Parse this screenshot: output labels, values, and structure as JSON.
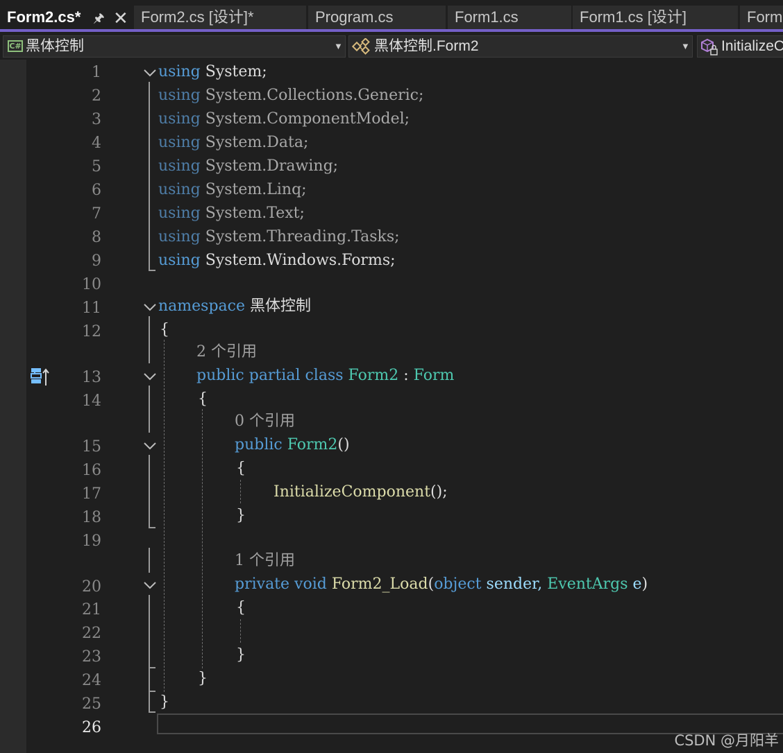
{
  "tabs": [
    {
      "label": "Form2.cs*",
      "active": true
    },
    {
      "label": "Form2.cs [设计]*",
      "active": false
    },
    {
      "label": "Program.cs",
      "active": false
    },
    {
      "label": "Form1.cs",
      "active": false
    },
    {
      "label": "Form1.cs [设计]",
      "active": false
    },
    {
      "label": "Form",
      "active": false
    }
  ],
  "navbar": {
    "project": "黑体控制",
    "type": "黑体控制.Form2",
    "member": "InitializeC"
  },
  "editor": {
    "current_line": 26,
    "line_numbers": [
      "1",
      "2",
      "3",
      "4",
      "5",
      "6",
      "7",
      "8",
      "9",
      "10",
      "11",
      "12",
      "13",
      "14",
      "15",
      "16",
      "17",
      "18",
      "19",
      "20",
      "21",
      "22",
      "23",
      "24",
      "25",
      "26"
    ],
    "tokens": {
      "using": "using",
      "system_semi": "System;",
      "collections": "System.Collections.Generic;",
      "componentmodel": "System.ComponentModel;",
      "data": "System.Data;",
      "drawing": "System.Drawing;",
      "linq": "System.Linq;",
      "text": "System.Text;",
      "tasks": "System.Threading.Tasks;",
      "forms": "System.Windows.Forms;",
      "namespace": "namespace",
      "ns_name": "黑体控制",
      "open_brace": "{",
      "close_brace": "}",
      "public": "public",
      "partial": "partial",
      "class": "class",
      "form2": "Form2",
      "colon": ":",
      "form": "Form",
      "ctor_parens": "()",
      "init_call": "InitializeComponent",
      "call_tail": "();",
      "private": "private",
      "void": "void",
      "load_name": "Form2_Load",
      "lparen": "(",
      "object": "object",
      "sender": "sender,",
      "eventargs": "EventArgs",
      "e_param": "e",
      "rparen": ")"
    },
    "codelens": {
      "class_refs": "2 个引用",
      "ctor_refs": "0 个引用",
      "load_refs": "1 个引用"
    }
  },
  "watermark": "CSDN @月阳羊",
  "colors": {
    "keyword": "#569cd6",
    "type": "#4ec9b0",
    "method": "#dcdcaa",
    "accent": "#7460c8"
  },
  "icons": {
    "pin": "pin-icon",
    "close": "close-icon",
    "csharp": "csharp-file-icon",
    "class": "class-icon",
    "member": "method-icon",
    "inherit": "inheritance-margin-icon",
    "collapse": "chevron-down-icon"
  }
}
